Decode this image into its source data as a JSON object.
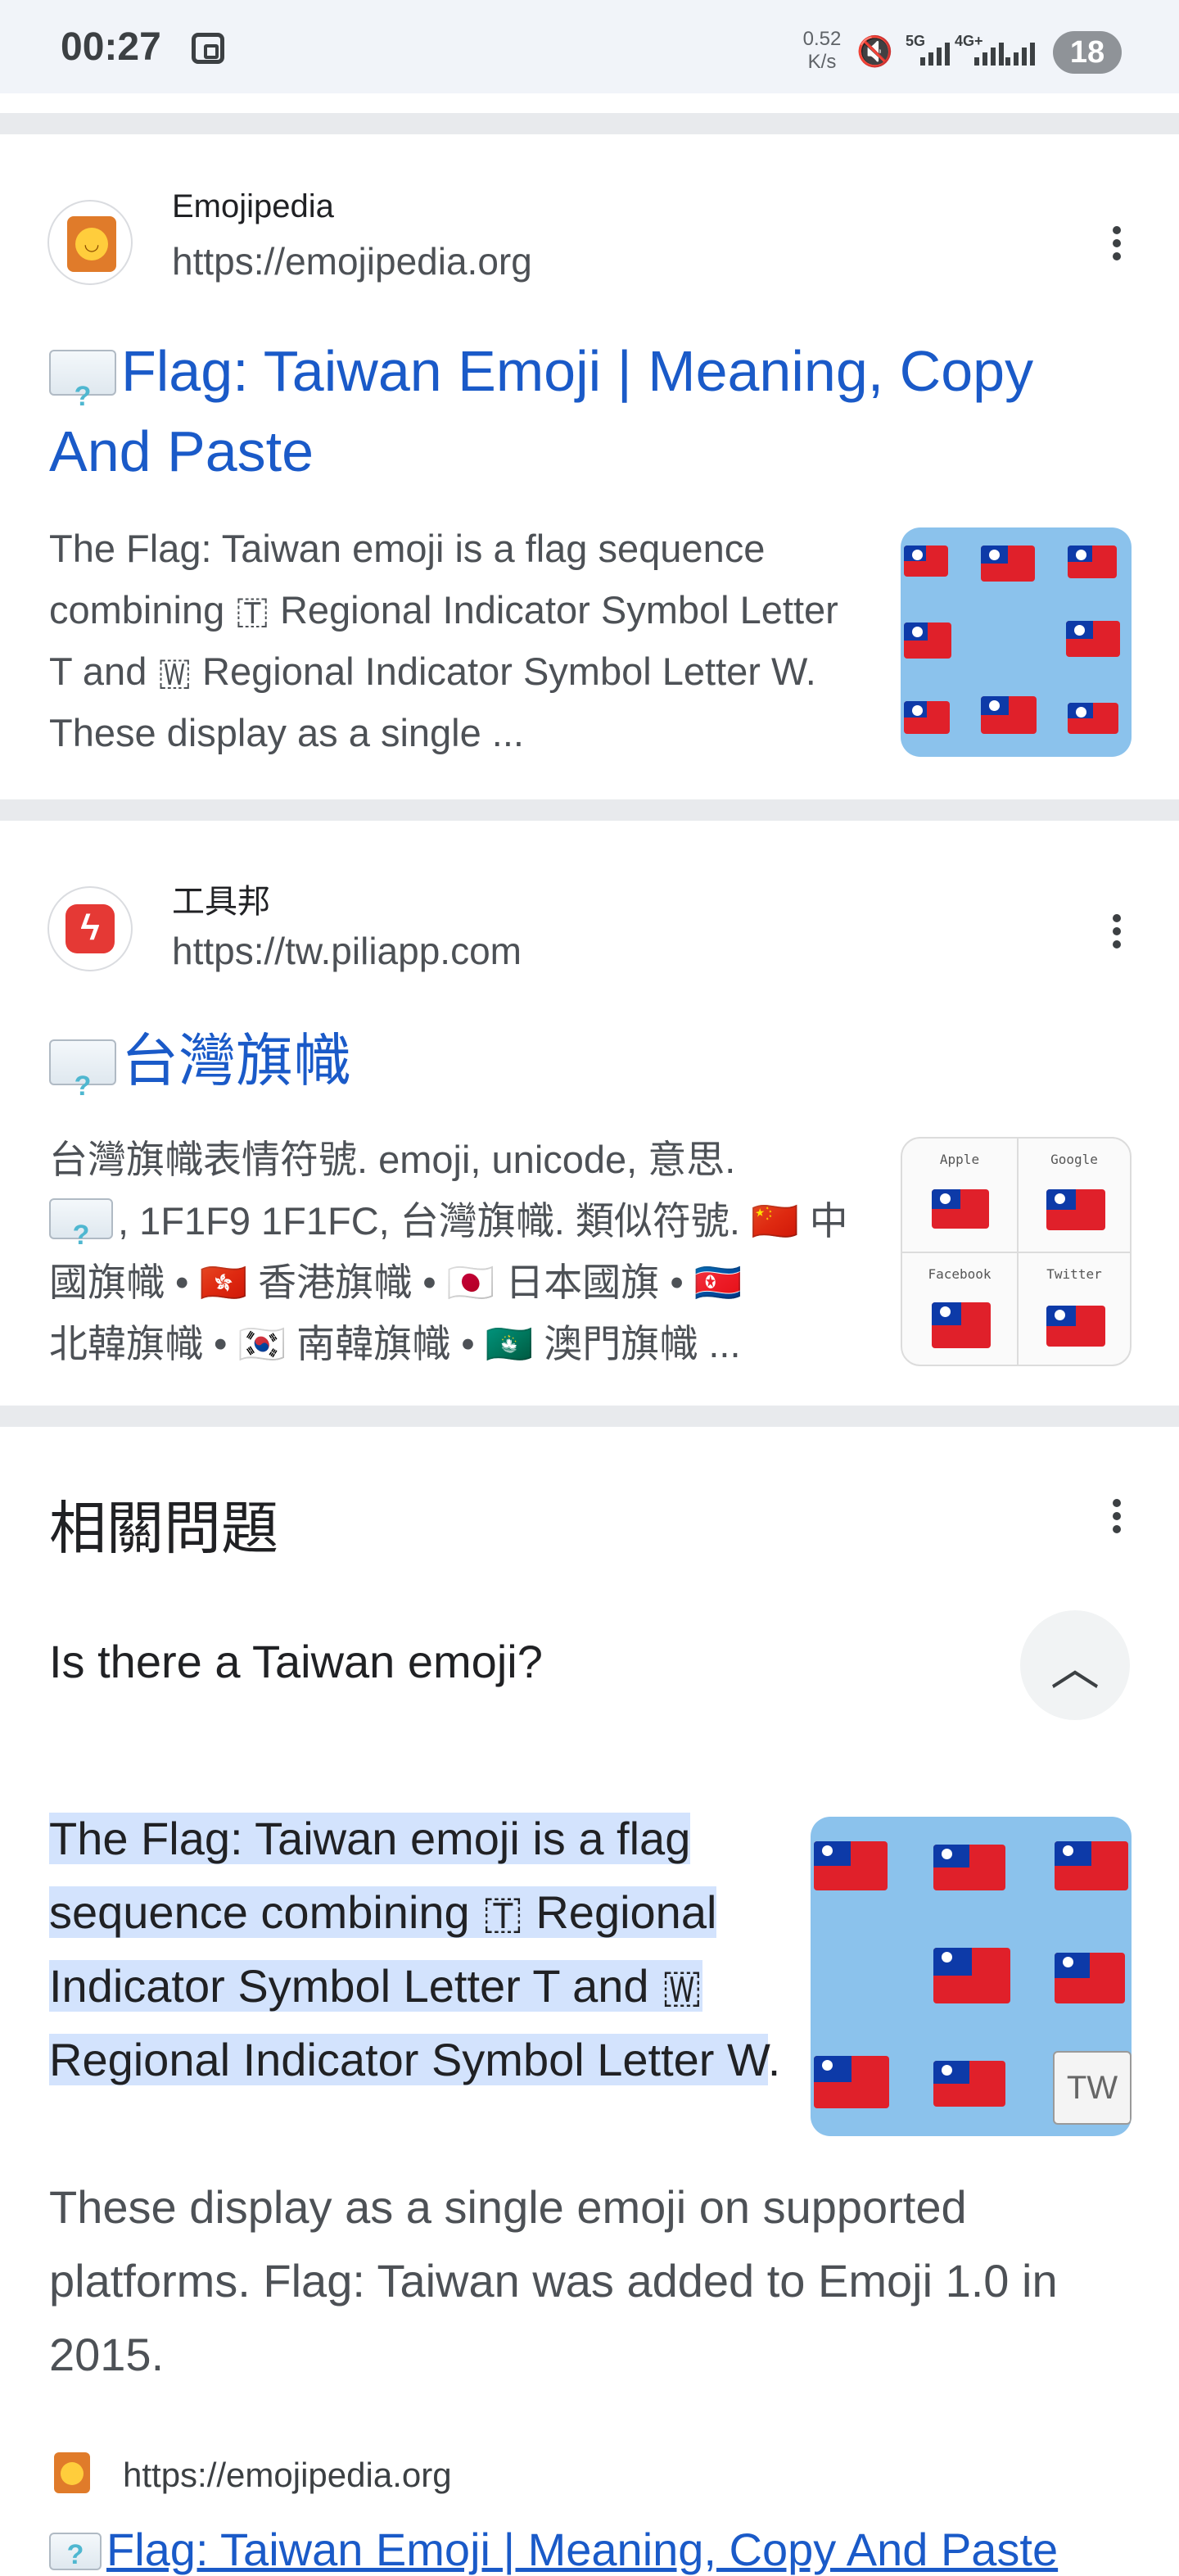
{
  "status_bar": {
    "time": "00:27",
    "net_speed": "0.52",
    "net_unit": "K/s",
    "net_type_1": "5G",
    "net_type_2": "4G+",
    "battery": "18"
  },
  "results": [
    {
      "site_name": "Emojipedia",
      "url": "https://emojipedia.org",
      "title": "Flag: Taiwan Emoji | Meaning, Copy And Paste",
      "snippet": "The Flag: Taiwan emoji is a flag sequence combining 🇹 Regional Indicator Symbol Letter T and 🇼 Regional Indicator Symbol Letter W. These display as a single ..."
    },
    {
      "site_name": "工具邦",
      "url": "https://tw.piliapp.com",
      "title": "台灣旗幟",
      "snippet_line1": "台灣旗幟表情符號. emoji, unicode, 意思.",
      "snippet_line2": ", 1F1F9 1F1FC, 台灣旗幟. 類似符號. 🇨🇳 中",
      "snippet_line3": "國旗幟 • 🇭🇰 香港旗幟 • 🇯🇵 日本國旗 • 🇰🇵",
      "snippet_line4": "北韓旗幟 • 🇰🇷 南韓旗幟 • 🇲🇴 澳門旗幟 ...",
      "thumb_labels": [
        "Apple",
        "Google",
        "Facebook",
        "Twitter"
      ]
    }
  ],
  "related": {
    "heading": "相關問題",
    "question": "Is there a Taiwan emoji?",
    "answer_highlight": "The Flag: Taiwan emoji is a flag sequence combining 🇹 Regional Indicator Symbol Letter T and 🇼 Regional Indicator Symbol Letter W",
    "answer_period": ".",
    "answer_rest": "These display as a single emoji on supported platforms. Flag: Taiwan was added to Emoji 1.0 in 2015.",
    "thumb_tw_label": "TW",
    "source_url": "https://emojipedia.org",
    "source_title": "Flag: Taiwan Emoji | Meaning, Copy And Paste"
  },
  "colors": {
    "link": "#1a5ac8",
    "highlight": "#d3e3fd",
    "thumb_bg": "#8bc2ec"
  },
  "icons": [
    "screenshot-icon",
    "mute-icon",
    "signal-icon",
    "kebab-menu-icon",
    "chevron-up-icon",
    "emojipedia-logo-icon",
    "piliapp-logo-icon"
  ]
}
